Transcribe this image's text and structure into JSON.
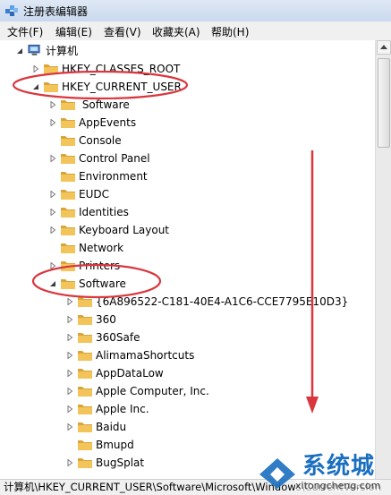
{
  "window": {
    "title": "注册表编辑器",
    "icon": "regedit-icon"
  },
  "menu": [
    "文件(F)",
    "编辑(E)",
    "查看(V)",
    "收藏夹(A)",
    "帮助(H)"
  ],
  "tree": {
    "root": "计算机",
    "items": [
      {
        "label": "HKEY_CLASSES_ROOT",
        "level": 1,
        "expander": "collapsed"
      },
      {
        "label": "HKEY_CURRENT_USER",
        "level": 1,
        "expander": "expanded"
      },
      {
        "label": " Software",
        "level": 2,
        "expander": "collapsed"
      },
      {
        "label": "AppEvents",
        "level": 2,
        "expander": "collapsed"
      },
      {
        "label": "Console",
        "level": 2,
        "expander": "none"
      },
      {
        "label": "Control Panel",
        "level": 2,
        "expander": "collapsed"
      },
      {
        "label": "Environment",
        "level": 2,
        "expander": "none"
      },
      {
        "label": "EUDC",
        "level": 2,
        "expander": "collapsed"
      },
      {
        "label": "Identities",
        "level": 2,
        "expander": "collapsed"
      },
      {
        "label": "Keyboard Layout",
        "level": 2,
        "expander": "collapsed"
      },
      {
        "label": "Network",
        "level": 2,
        "expander": "none"
      },
      {
        "label": "Printers",
        "level": 2,
        "expander": "collapsed"
      },
      {
        "label": "Software",
        "level": 2,
        "expander": "expanded"
      },
      {
        "label": "{6A896522-C181-40E4-A1C6-CCE7795E10D3}",
        "level": 3,
        "expander": "collapsed"
      },
      {
        "label": "360",
        "level": 3,
        "expander": "collapsed"
      },
      {
        "label": "360Safe",
        "level": 3,
        "expander": "collapsed"
      },
      {
        "label": "AlimamaShortcuts",
        "level": 3,
        "expander": "collapsed"
      },
      {
        "label": "AppDataLow",
        "level": 3,
        "expander": "collapsed"
      },
      {
        "label": "Apple Computer, Inc.",
        "level": 3,
        "expander": "collapsed"
      },
      {
        "label": "Apple Inc.",
        "level": 3,
        "expander": "collapsed"
      },
      {
        "label": "Baidu",
        "level": 3,
        "expander": "collapsed"
      },
      {
        "label": "Bmupd",
        "level": 3,
        "expander": "none"
      },
      {
        "label": "BugSplat",
        "level": 3,
        "expander": "collapsed"
      }
    ]
  },
  "statusbar": {
    "path": "计算机\\HKEY_CURRENT_USER\\Software\\Microsoft\\Windows\\CurrentVersion"
  },
  "watermark": {
    "text": "系统城",
    "sub": "xitongcheng.com"
  },
  "colors": {
    "annotation": "#d9363e",
    "folder": "#f2c45a",
    "folder_dark": "#d9a53a",
    "watermark": "#1a6fc0"
  }
}
